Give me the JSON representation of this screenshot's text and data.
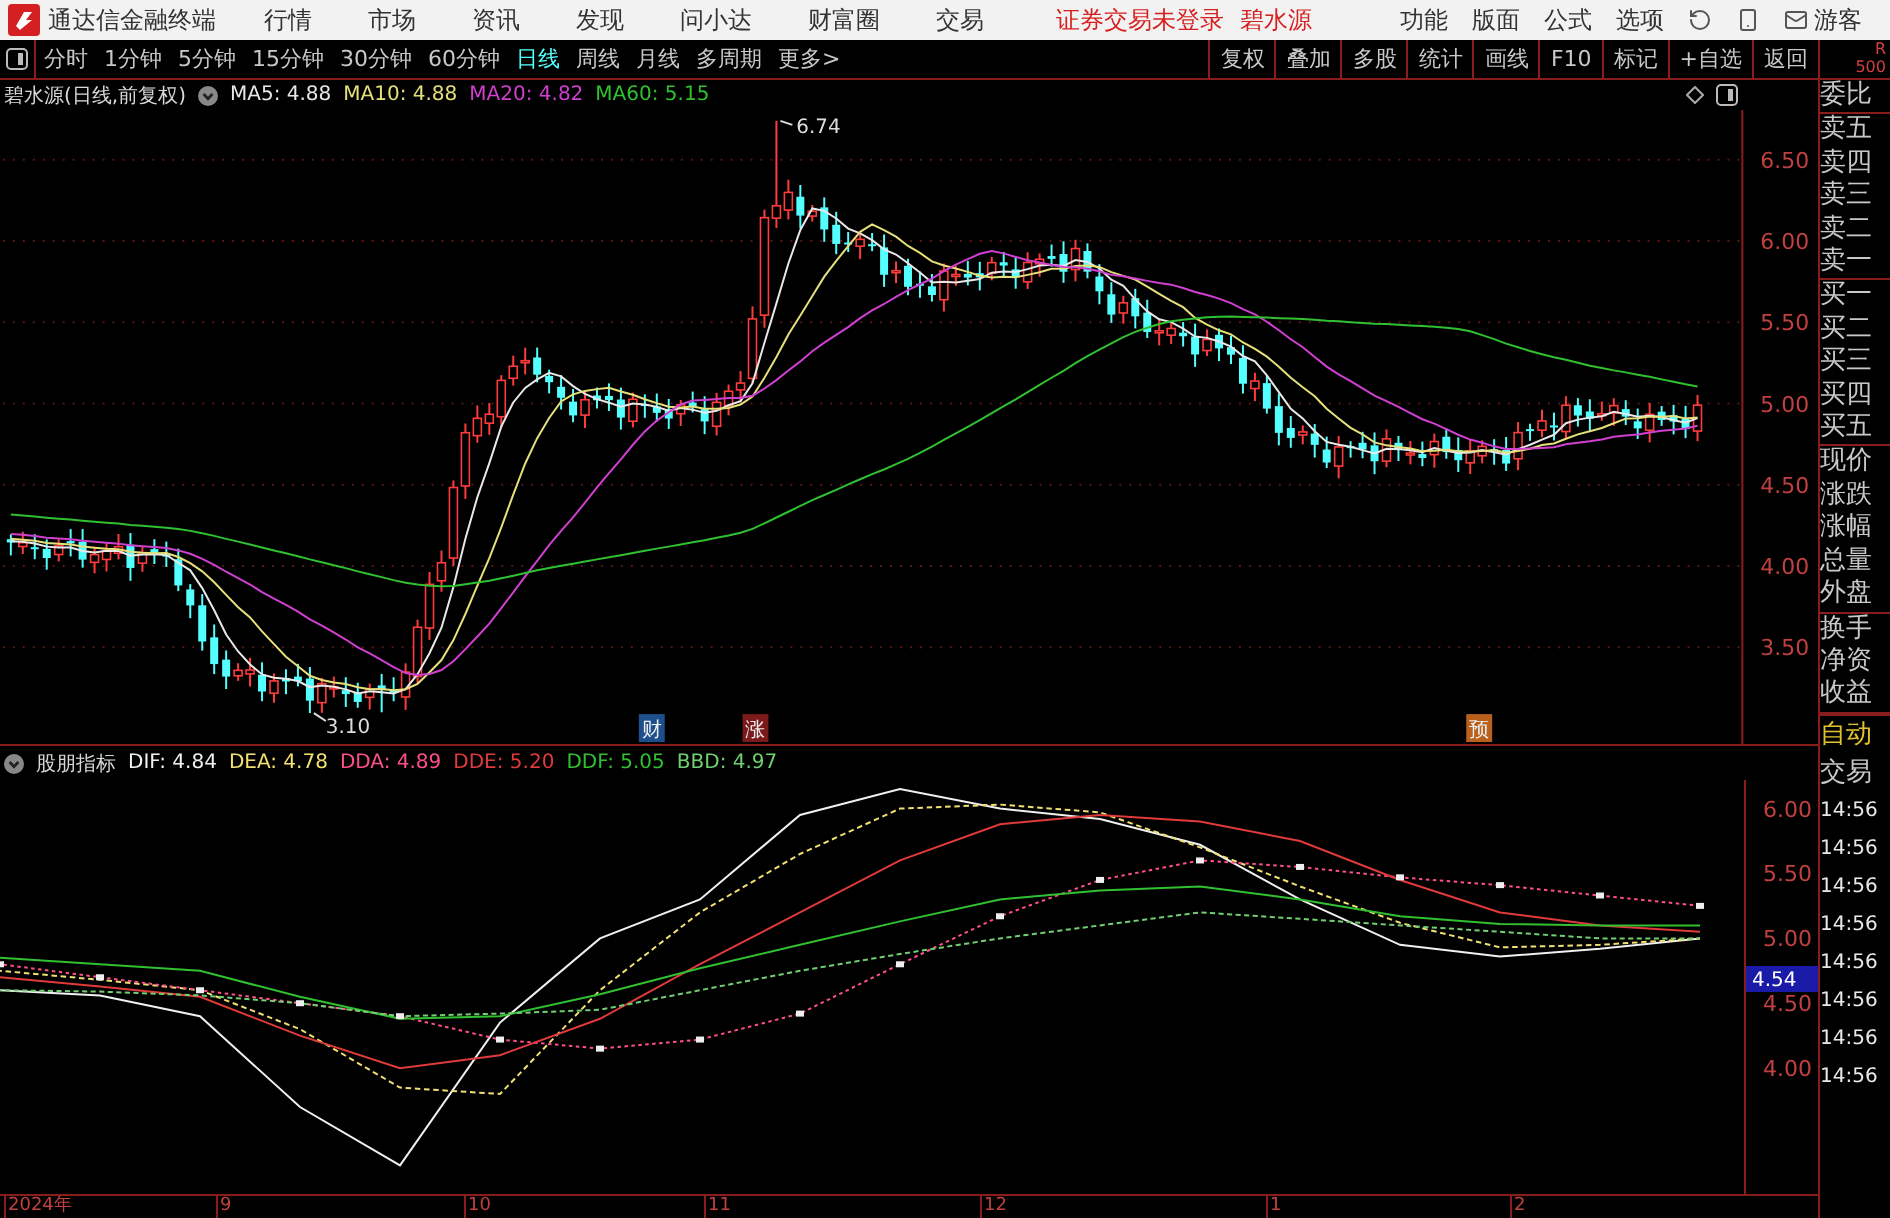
{
  "menu_bar": {
    "app_title": "通达信金融终端",
    "menus": [
      "行情",
      "市场",
      "资讯",
      "发现",
      "问小达",
      "财富圈",
      "交易"
    ],
    "status": "证券交易未登录",
    "stock": "碧水源",
    "right_menus": [
      "功能",
      "版面",
      "公式",
      "选项"
    ],
    "user": "游客"
  },
  "toolbar": {
    "periods": [
      {
        "label": "分时",
        "selected": false
      },
      {
        "label": "1分钟",
        "selected": false
      },
      {
        "label": "5分钟",
        "selected": false
      },
      {
        "label": "15分钟",
        "selected": false
      },
      {
        "label": "30分钟",
        "selected": false
      },
      {
        "label": "60分钟",
        "selected": false
      },
      {
        "label": "日线",
        "selected": true
      },
      {
        "label": "周线",
        "selected": false
      },
      {
        "label": "月线",
        "selected": false
      },
      {
        "label": "多周期",
        "selected": false
      },
      {
        "label": "更多>",
        "selected": false
      }
    ],
    "buttons": [
      "复权",
      "叠加",
      "多股",
      "统计",
      "画线",
      "F10",
      "标记",
      "+自选",
      "返回"
    ]
  },
  "price_chart": {
    "title": "碧水源(日线,前复权)",
    "ma": [
      {
        "label": "MA5: 4.88",
        "color": "#e8e8e8"
      },
      {
        "label": "MA10: 4.88",
        "color": "#e6e07a"
      },
      {
        "label": "MA20: 4.82",
        "color": "#d040d0"
      },
      {
        "label": "MA60: 5.15",
        "color": "#30c030"
      }
    ],
    "y_labels": [
      "6.50",
      "6.00",
      "5.50",
      "5.00",
      "4.50",
      "4.00",
      "3.50"
    ],
    "annotations": [
      "6.74",
      "3.10"
    ],
    "events": [
      {
        "label": "财",
        "color": "#1c4f8c"
      },
      {
        "label": "涨",
        "color": "#7a1a1a"
      },
      {
        "label": "预",
        "color": "#b8601c"
      }
    ]
  },
  "indicator_chart": {
    "title": "股朋指标",
    "chart_data": {
      "type": "line",
      "yticks": [
        {
          "value": 6,
          "label": "6.00"
        },
        {
          "value": 5.5,
          "label": "5.50"
        },
        {
          "value": 5,
          "label": "5.00"
        },
        {
          "value": 4.5,
          "label": "4.50"
        },
        {
          "value": 4,
          "label": "4.00"
        }
      ],
      "ylim": [
        3.03,
        6.22
      ],
      "series": [
        {
          "name": "DIF: 4.84",
          "color": "#f0f0f0",
          "line_style": "solid",
          "values": [
            4.6,
            4.56,
            4.4,
            3.7,
            3.25,
            4.35,
            5.0,
            5.3,
            5.95,
            6.15,
            6.0,
            5.92,
            5.72,
            5.3,
            4.95,
            4.86,
            4.92,
            5.0
          ]
        },
        {
          "name": "DEA: 4.78",
          "color": "#f0e070",
          "line_style": "dashed",
          "values": [
            4.75,
            4.68,
            4.6,
            4.3,
            3.85,
            3.8,
            4.6,
            5.2,
            5.65,
            6.0,
            6.03,
            5.97,
            5.7,
            5.4,
            5.12,
            4.93,
            4.95,
            5.0
          ]
        },
        {
          "name": "DDA: 4.89",
          "color": "#ff4f8a",
          "line_style": "dotted",
          "marker": "square",
          "values": [
            4.8,
            4.7,
            4.6,
            4.5,
            4.4,
            4.22,
            4.15,
            4.22,
            4.42,
            4.8,
            5.17,
            5.45,
            5.6,
            5.55,
            5.47,
            5.41,
            5.33,
            5.25
          ]
        },
        {
          "name": "DDE: 5.20",
          "color": "#e03a3a",
          "line_style": "solid",
          "values": [
            4.7,
            4.63,
            4.55,
            4.25,
            4.0,
            4.1,
            4.38,
            4.8,
            5.2,
            5.6,
            5.88,
            5.95,
            5.9,
            5.75,
            5.45,
            5.2,
            5.1,
            5.05
          ]
        },
        {
          "name": "DDF: 5.05",
          "color": "#30c030",
          "line_style": "solid",
          "values": [
            4.85,
            4.8,
            4.75,
            4.55,
            4.38,
            4.4,
            4.57,
            4.77,
            4.95,
            5.13,
            5.3,
            5.37,
            5.4,
            5.3,
            5.17,
            5.11,
            5.1,
            5.1
          ]
        },
        {
          "name": "BBD: 4.97",
          "color": "#70d070",
          "line_style": "dashed",
          "values": [
            4.6,
            4.59,
            4.56,
            4.5,
            4.4,
            4.42,
            4.45,
            4.6,
            4.75,
            4.88,
            5.0,
            5.1,
            5.2,
            5.15,
            5.1,
            5.05,
            5.0,
            5.0
          ]
        }
      ]
    },
    "current": "4.54"
  },
  "date_axis": [
    "2024年",
    "9",
    "10",
    "11",
    "12",
    "1",
    "2"
  ],
  "quote_panel": {
    "corner": [
      "R",
      "500"
    ],
    "groups": [
      [
        "委比"
      ],
      [
        "卖五",
        "卖四",
        "卖三",
        "卖二",
        "卖一"
      ],
      [
        "买一",
        "买二",
        "买三",
        "买四",
        "买五"
      ],
      [
        "现价",
        "涨跌",
        "涨幅",
        "总量",
        "外盘"
      ],
      [
        "换手",
        "净资",
        "收益"
      ]
    ],
    "mode": "自动",
    "trade": "交易",
    "times": [
      "14:56",
      "14:56",
      "14:56",
      "14:56",
      "14:56",
      "14:56",
      "14:56",
      "14:56"
    ]
  }
}
